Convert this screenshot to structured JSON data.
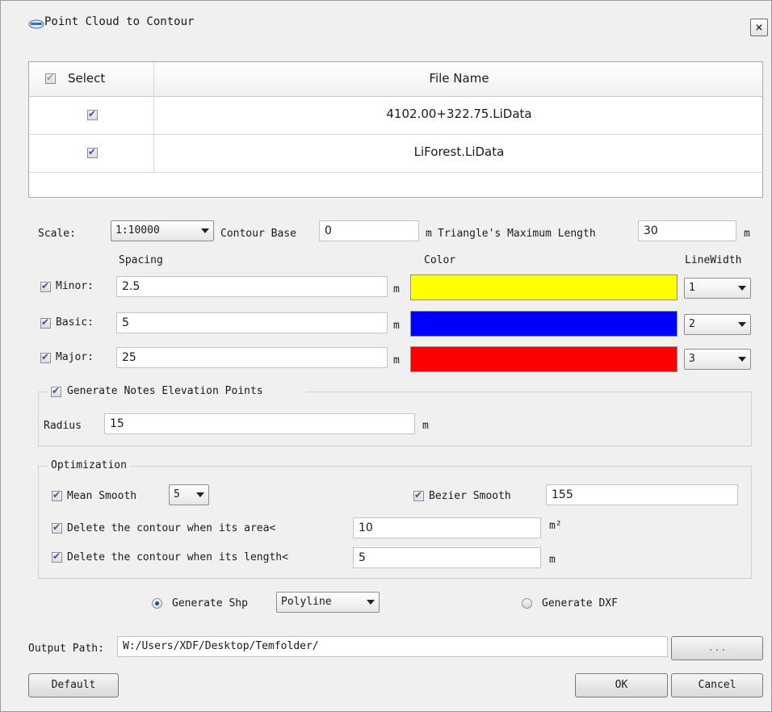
{
  "window": {
    "title": "Point Cloud to Contour",
    "close_label": "×"
  },
  "files": {
    "headers": {
      "select": "Select",
      "file_name": "File Name"
    },
    "rows": [
      {
        "checked": true,
        "name": "4102.00+322.75.LiData"
      },
      {
        "checked": true,
        "name": "LiForest.LiData"
      }
    ]
  },
  "params": {
    "scale_label": "Scale:",
    "scale_value": "1:10000",
    "contour_base_label": "Contour Base",
    "contour_base_value": "0",
    "contour_base_unit": "m",
    "triangle_label": "Triangle's Maximum Length",
    "triangle_value": "30",
    "triangle_unit": "m"
  },
  "columns": {
    "spacing": "Spacing",
    "color": "Color",
    "linewidth": "LineWidth"
  },
  "contours": {
    "minor": {
      "label": "Minor:",
      "spacing": "2.5",
      "unit": "m",
      "color": "#ffff00",
      "width": "1"
    },
    "basic": {
      "label": "Basic:",
      "spacing": "5",
      "unit": "m",
      "color": "#0000ff",
      "width": "2"
    },
    "major": {
      "label": "Major:",
      "spacing": "25",
      "unit": "m",
      "color": "#ff0000",
      "width": "3"
    }
  },
  "notes": {
    "label": "Generate Notes Elevation Points",
    "radius_label": "Radius",
    "radius_value": "15",
    "radius_unit": "m"
  },
  "optimization": {
    "title": "Optimization",
    "mean_smooth_label": "Mean Smooth",
    "mean_smooth_value": "5",
    "bezier_label": "Bezier Smooth",
    "bezier_value": "155",
    "del_area_label": "Delete the contour when its area<",
    "del_area_value": "10",
    "del_area_unit": "m²",
    "del_length_label": "Delete the contour when its length<",
    "del_length_value": "5",
    "del_length_unit": "m"
  },
  "output": {
    "shp_label": "Generate Shp",
    "shp_type": "Polyline",
    "dxf_label": "Generate DXF",
    "path_label": "Output Path:",
    "path_value": "W:/Users/XDF/Desktop/Temfolder/",
    "browse_label": "..."
  },
  "buttons": {
    "default": "Default",
    "ok": "OK",
    "cancel": "Cancel"
  }
}
